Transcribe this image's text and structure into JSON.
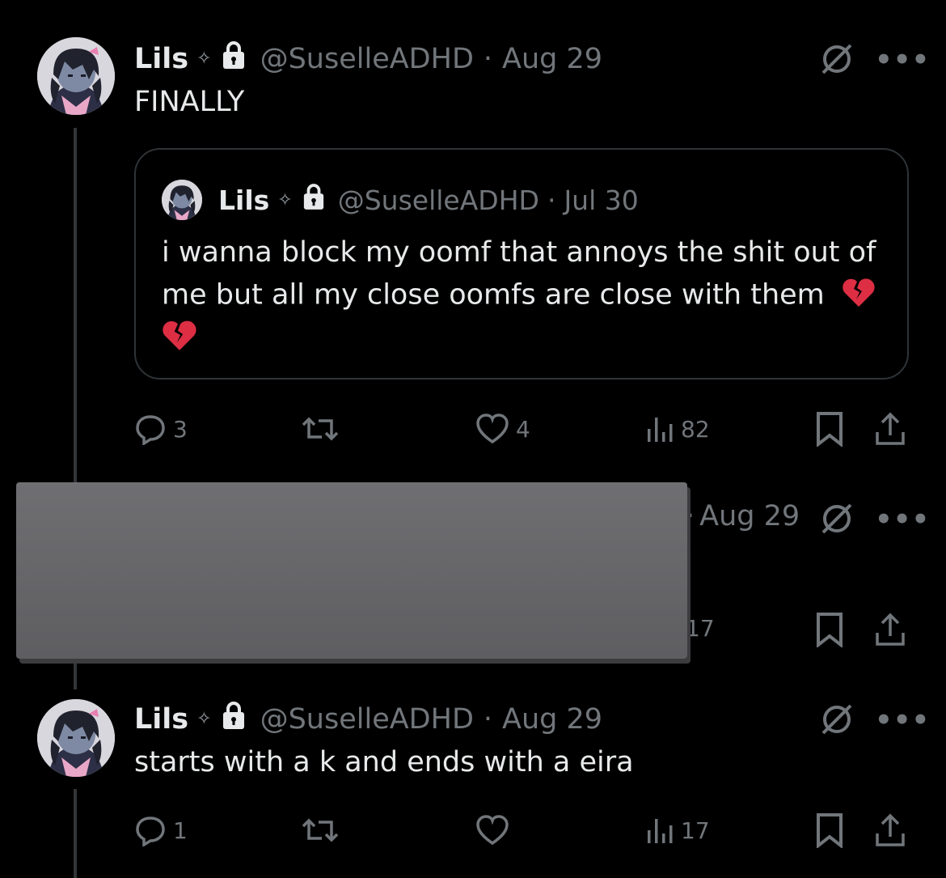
{
  "posts": [
    {
      "name": "Lils",
      "handle": "@SuselleADHD",
      "sep": "·",
      "date": "Aug 29",
      "text": "FINALLY",
      "quote": {
        "name": "Lils",
        "handle": "@SuselleADHD",
        "sep": "·",
        "date": "Jul 30",
        "line1": "i wanna block my oomf that annoys the shit out of",
        "line2": "me but all my close oomfs are close with them"
      },
      "stats": {
        "replies": "3",
        "likes": "4",
        "views": "82"
      }
    },
    {
      "date": "Aug 29",
      "views": "17"
    },
    {
      "name": "Lils",
      "handle": "@SuselleADHD",
      "sep": "·",
      "date": "Aug 29",
      "text": "starts with a k and ends with a eira",
      "stats": {
        "replies": "1",
        "views": "17"
      }
    }
  ],
  "icons": {
    "verified": "sparkle-icon",
    "protected": "lock-icon",
    "grok": "grok-icon",
    "more": "more-icon"
  },
  "more_glyph": "•••",
  "sparkle_glyph": "✧",
  "colors": {
    "bg": "#000000",
    "text": "#e7e9ea",
    "muted": "#71767b",
    "border": "#2f3336",
    "heart_emoji": "#dd2e44"
  }
}
